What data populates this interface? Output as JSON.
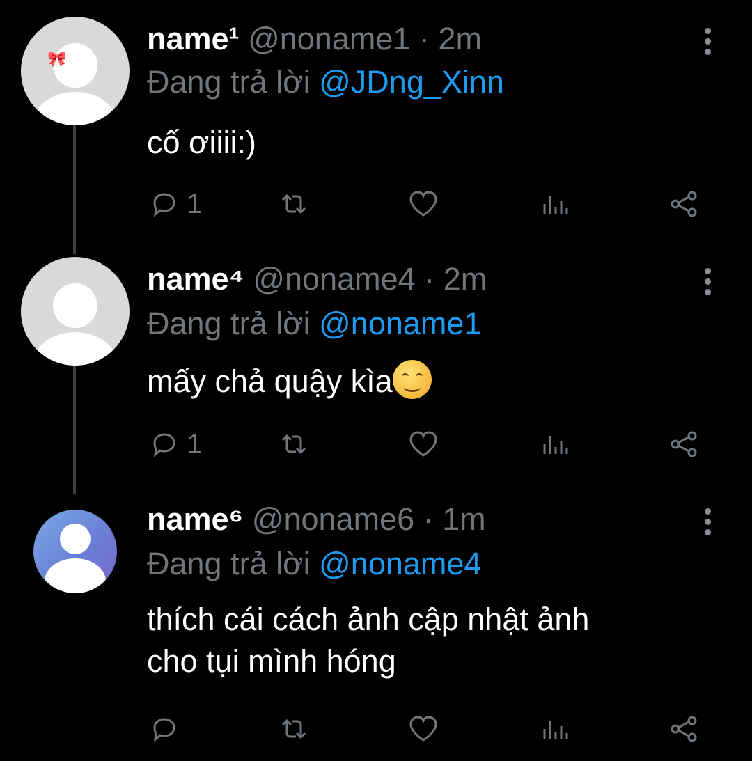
{
  "tweets": [
    {
      "name": "name¹",
      "handle": "@noname1",
      "separator": "·",
      "time": "2m",
      "reply_prefix": "Đang trả lời",
      "reply_to": "@JDng_Xinn",
      "text": "cố ơiiii:)",
      "reply_count": "1",
      "avatar_icon": "default-avatar-with-bow-icon"
    },
    {
      "name": "name⁴",
      "handle": "@noname4",
      "separator": "·",
      "time": "2m",
      "reply_prefix": "Đang trả lời",
      "reply_to": "@noname1",
      "text": "mấy chả quậy kìa",
      "text_emoji": "smiling-face-icon",
      "reply_count": "1",
      "avatar_icon": "default-avatar-icon"
    },
    {
      "name": "name⁶",
      "handle": "@noname6",
      "separator": "·",
      "time": "1m",
      "reply_prefix": "Đang trả lời",
      "reply_to": "@noname4",
      "text_line1": "thích cái cách ảnh cập nhật ảnh",
      "text_line2": "cho tụi mình hóng",
      "reply_count": "",
      "avatar_icon": "default-avatar-blue-icon"
    }
  ],
  "colors": {
    "background": "#000000",
    "mention": "#1d9bf0",
    "muted": "#71767b",
    "primary_text": "#ffffff"
  }
}
